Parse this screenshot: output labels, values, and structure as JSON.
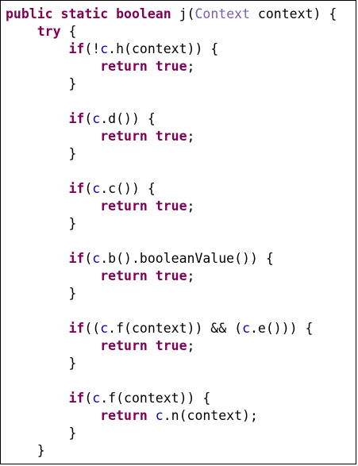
{
  "colors": {
    "keyword": "#7f0055",
    "type": "#7b5ea7",
    "field": "#0000c0",
    "text": "#000000",
    "border": "#000000",
    "background": "#ffffff"
  },
  "code_lines": [
    [
      {
        "t": "kw",
        "v": "public"
      },
      {
        "t": "plain",
        "v": " "
      },
      {
        "t": "kw",
        "v": "static"
      },
      {
        "t": "plain",
        "v": " "
      },
      {
        "t": "kw",
        "v": "boolean"
      },
      {
        "t": "plain",
        "v": " j("
      },
      {
        "t": "type",
        "v": "Context"
      },
      {
        "t": "plain",
        "v": " context) {"
      }
    ],
    [
      {
        "t": "plain",
        "v": "    "
      },
      {
        "t": "kw",
        "v": "try"
      },
      {
        "t": "plain",
        "v": " {"
      }
    ],
    [
      {
        "t": "plain",
        "v": "        "
      },
      {
        "t": "kw",
        "v": "if"
      },
      {
        "t": "plain",
        "v": "(!"
      },
      {
        "t": "field",
        "v": "c"
      },
      {
        "t": "plain",
        "v": ".h(context)) {"
      }
    ],
    [
      {
        "t": "plain",
        "v": "            "
      },
      {
        "t": "kw",
        "v": "return"
      },
      {
        "t": "plain",
        "v": " "
      },
      {
        "t": "kw",
        "v": "true"
      },
      {
        "t": "plain",
        "v": ";"
      }
    ],
    [
      {
        "t": "plain",
        "v": "        }"
      }
    ],
    [],
    [
      {
        "t": "plain",
        "v": "        "
      },
      {
        "t": "kw",
        "v": "if"
      },
      {
        "t": "plain",
        "v": "("
      },
      {
        "t": "field",
        "v": "c"
      },
      {
        "t": "plain",
        "v": ".d()) {"
      }
    ],
    [
      {
        "t": "plain",
        "v": "            "
      },
      {
        "t": "kw",
        "v": "return"
      },
      {
        "t": "plain",
        "v": " "
      },
      {
        "t": "kw",
        "v": "true"
      },
      {
        "t": "plain",
        "v": ";"
      }
    ],
    [
      {
        "t": "plain",
        "v": "        }"
      }
    ],
    [],
    [
      {
        "t": "plain",
        "v": "        "
      },
      {
        "t": "kw",
        "v": "if"
      },
      {
        "t": "plain",
        "v": "("
      },
      {
        "t": "field",
        "v": "c"
      },
      {
        "t": "plain",
        "v": ".c()) {"
      }
    ],
    [
      {
        "t": "plain",
        "v": "            "
      },
      {
        "t": "kw",
        "v": "return"
      },
      {
        "t": "plain",
        "v": " "
      },
      {
        "t": "kw",
        "v": "true"
      },
      {
        "t": "plain",
        "v": ";"
      }
    ],
    [
      {
        "t": "plain",
        "v": "        }"
      }
    ],
    [],
    [
      {
        "t": "plain",
        "v": "        "
      },
      {
        "t": "kw",
        "v": "if"
      },
      {
        "t": "plain",
        "v": "("
      },
      {
        "t": "field",
        "v": "c"
      },
      {
        "t": "plain",
        "v": ".b().booleanValue()) {"
      }
    ],
    [
      {
        "t": "plain",
        "v": "            "
      },
      {
        "t": "kw",
        "v": "return"
      },
      {
        "t": "plain",
        "v": " "
      },
      {
        "t": "kw",
        "v": "true"
      },
      {
        "t": "plain",
        "v": ";"
      }
    ],
    [
      {
        "t": "plain",
        "v": "        }"
      }
    ],
    [],
    [
      {
        "t": "plain",
        "v": "        "
      },
      {
        "t": "kw",
        "v": "if"
      },
      {
        "t": "plain",
        "v": "(("
      },
      {
        "t": "field",
        "v": "c"
      },
      {
        "t": "plain",
        "v": ".f(context)) && ("
      },
      {
        "t": "field",
        "v": "c"
      },
      {
        "t": "plain",
        "v": ".e())) {"
      }
    ],
    [
      {
        "t": "plain",
        "v": "            "
      },
      {
        "t": "kw",
        "v": "return"
      },
      {
        "t": "plain",
        "v": " "
      },
      {
        "t": "kw",
        "v": "true"
      },
      {
        "t": "plain",
        "v": ";"
      }
    ],
    [
      {
        "t": "plain",
        "v": "        }"
      }
    ],
    [],
    [
      {
        "t": "plain",
        "v": "        "
      },
      {
        "t": "kw",
        "v": "if"
      },
      {
        "t": "plain",
        "v": "("
      },
      {
        "t": "field",
        "v": "c"
      },
      {
        "t": "plain",
        "v": ".f(context)) {"
      }
    ],
    [
      {
        "t": "plain",
        "v": "            "
      },
      {
        "t": "kw",
        "v": "return"
      },
      {
        "t": "plain",
        "v": " "
      },
      {
        "t": "field",
        "v": "c"
      },
      {
        "t": "plain",
        "v": ".n(context);"
      }
    ],
    [
      {
        "t": "plain",
        "v": "        }"
      }
    ],
    [
      {
        "t": "plain",
        "v": "    }"
      }
    ]
  ]
}
